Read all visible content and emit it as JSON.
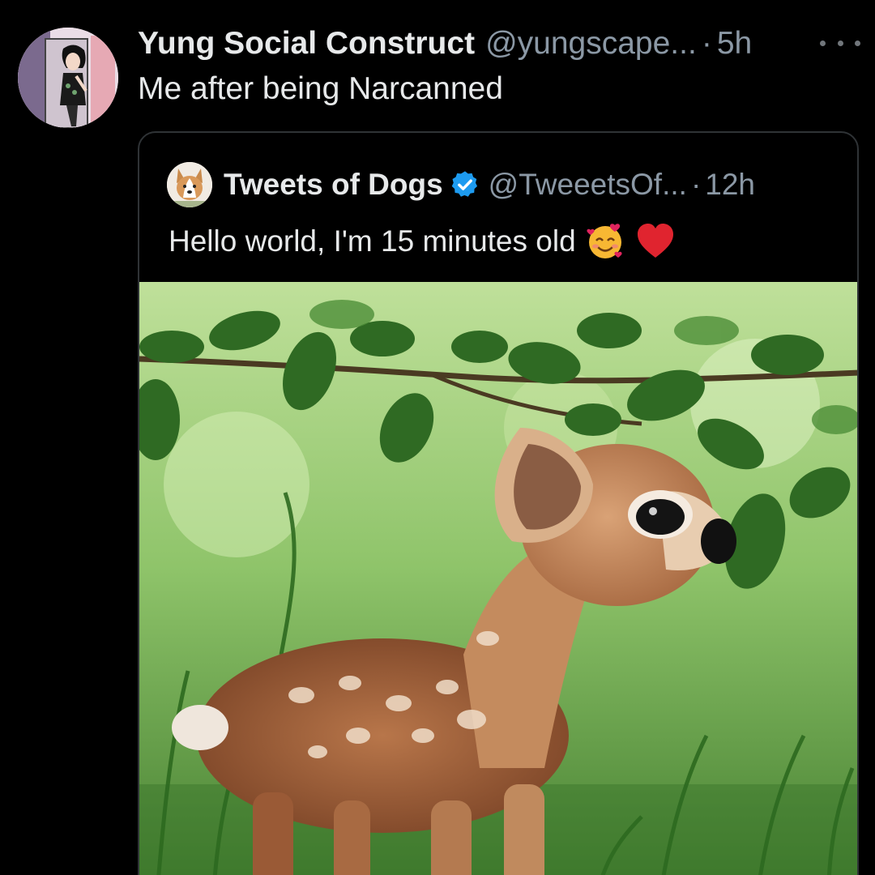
{
  "tweet": {
    "author": {
      "display_name": "Yung Social Construct",
      "handle": "@yungscape...",
      "separator": "·",
      "time": "5h"
    },
    "text": "Me after being Narcanned",
    "more_icon": "more-horizontal-icon"
  },
  "quoted_tweet": {
    "author": {
      "display_name": "Tweets of Dogs",
      "verified": true,
      "handle": "@TweeetsOf...",
      "separator": "·",
      "time": "12h"
    },
    "text": "Hello world, I'm 15 minutes old",
    "emojis": [
      "smiling-face-with-hearts-emoji",
      "red-heart-emoji"
    ],
    "media": "photo of a newborn spotted fawn standing in green grass under leafy branches"
  },
  "colors": {
    "background": "#000000",
    "text_primary": "#e7e9ea",
    "text_secondary": "#8b98a5",
    "border": "#2f3336",
    "verified_blue": "#1d9bf0"
  }
}
